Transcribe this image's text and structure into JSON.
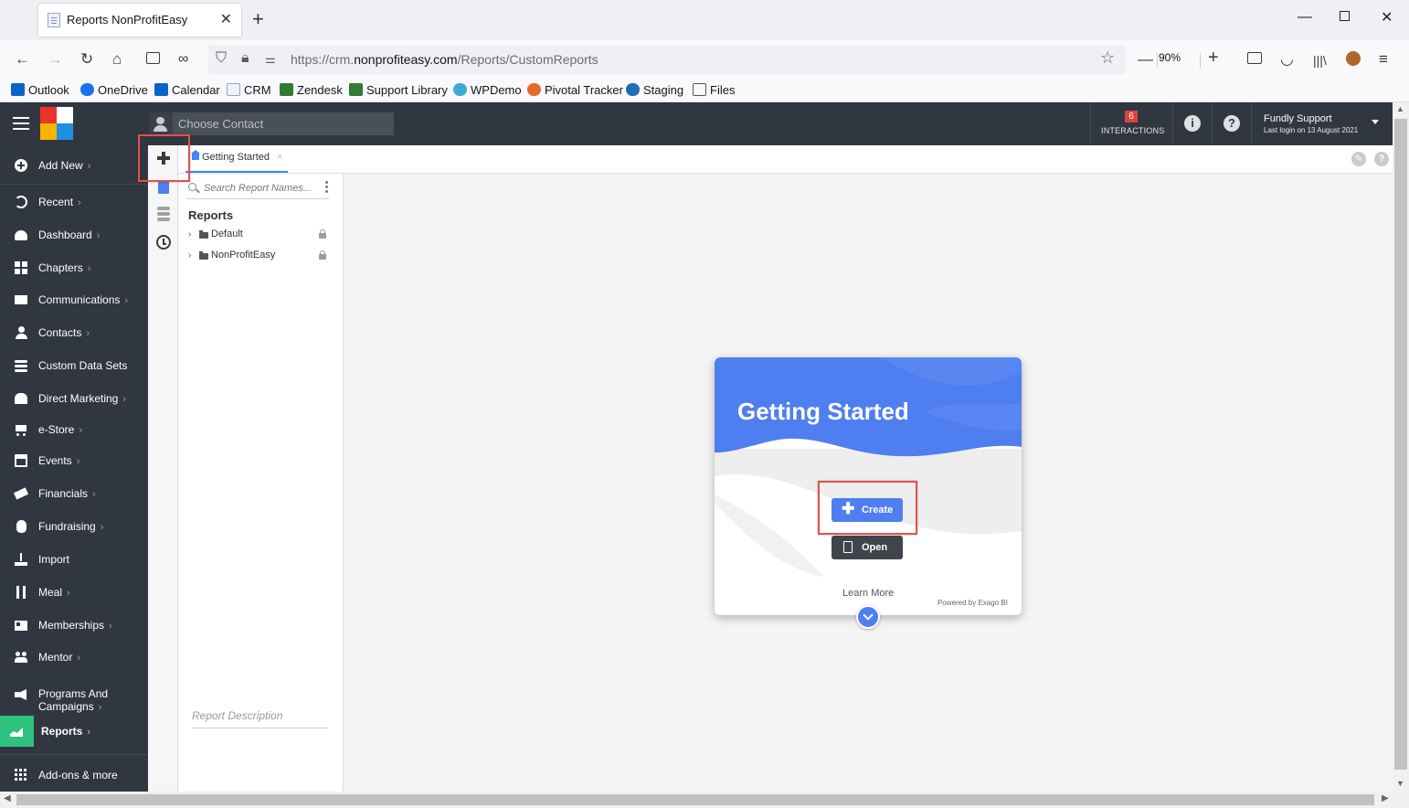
{
  "browser": {
    "tab_title": "Reports NonProfitEasy",
    "url_prefix": "https://crm.",
    "url_domain": "nonprofiteasy.com",
    "url_path": "/Reports/CustomReports",
    "zoom": "90%"
  },
  "bookmarks": [
    {
      "label": "Outlook",
      "color": "#0a64c8"
    },
    {
      "label": "OneDrive",
      "color": "#1a73e8"
    },
    {
      "label": "Calendar",
      "color": "#0a64c8"
    },
    {
      "label": "CRM",
      "color": "#8fa7c8"
    },
    {
      "label": "Zendesk",
      "color": "#2e7d32"
    },
    {
      "label": "Support Library",
      "color": "#2e7d32"
    },
    {
      "label": "WPDemo",
      "color": "#3fa9d6"
    },
    {
      "label": "Pivotal Tracker",
      "color": "#e56a28"
    },
    {
      "label": "Staging",
      "color": "#1e6fb3"
    },
    {
      "label": "Files",
      "color": "#555555"
    }
  ],
  "header": {
    "contact_placeholder": "Choose Contact",
    "interactions_count": "6",
    "interactions_label": "INTERACTIONS",
    "user_name": "Fundly Support",
    "last_login": "Last login on 13 August 2021"
  },
  "sidebar": {
    "add_new": "Add New",
    "items": [
      {
        "label": "Recent",
        "chevron": true
      },
      {
        "label": "Dashboard",
        "chevron": true
      },
      {
        "label": "Chapters",
        "chevron": true
      },
      {
        "label": "Communications",
        "chevron": true
      },
      {
        "label": "Contacts",
        "chevron": true
      },
      {
        "label": "Custom Data Sets",
        "chevron": false
      },
      {
        "label": "Direct Marketing",
        "chevron": true
      },
      {
        "label": "e-Store",
        "chevron": true
      },
      {
        "label": "Events",
        "chevron": true
      },
      {
        "label": "Financials",
        "chevron": true
      },
      {
        "label": "Fundraising",
        "chevron": true
      },
      {
        "label": "Import",
        "chevron": false
      },
      {
        "label": "Meal",
        "chevron": true
      },
      {
        "label": "Memberships",
        "chevron": true
      },
      {
        "label": "Mentor",
        "chevron": true
      },
      {
        "label": "Programs And Campaigns",
        "chevron": true
      },
      {
        "label": "Reports",
        "chevron": true
      },
      {
        "label": "Add-ons & more",
        "chevron": false
      }
    ],
    "chevron": "›"
  },
  "reports": {
    "tab_label": "Getting Started",
    "search_placeholder": "Search Report Names...",
    "tree_title": "Reports",
    "folders": [
      "Default",
      "NonProfitEasy"
    ],
    "description_placeholder": "Report Description"
  },
  "card": {
    "title": "Getting Started",
    "create_label": "Create",
    "open_label": "Open",
    "learn_more": "Learn More",
    "powered_by": "Powered by Exago BI"
  },
  "colors": {
    "header_bg": "#313741",
    "accent_blue": "#4e7ef0",
    "active_green": "#2ec27e",
    "highlight_red": "#e5504a"
  }
}
